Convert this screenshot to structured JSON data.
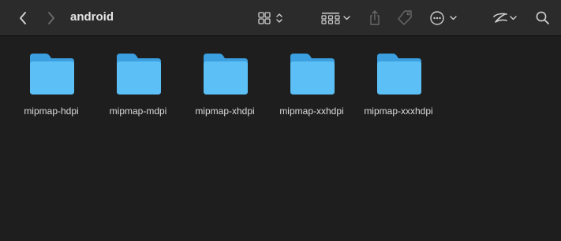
{
  "window": {
    "title": "android"
  },
  "toolbar": {
    "icons": {
      "back": "chevron-left-icon",
      "forward": "chevron-right-icon",
      "view": "grid-view-icon",
      "group": "group-by-icon",
      "share": "share-icon",
      "tags": "tag-icon",
      "more": "ellipsis-circle-icon",
      "extensions": "extension-icon",
      "search": "search-icon"
    }
  },
  "folders": [
    {
      "name": "mipmap-hdpi"
    },
    {
      "name": "mipmap-mdpi"
    },
    {
      "name": "mipmap-xhdpi"
    },
    {
      "name": "mipmap-xxhdpi"
    },
    {
      "name": "mipmap-xxxhdpi"
    }
  ],
  "colors": {
    "folder_back": "#3c9fe0",
    "folder_front": "#5cc0f6",
    "toolbar_bg": "#2b2b2b",
    "content_bg": "#1e1e1e"
  }
}
